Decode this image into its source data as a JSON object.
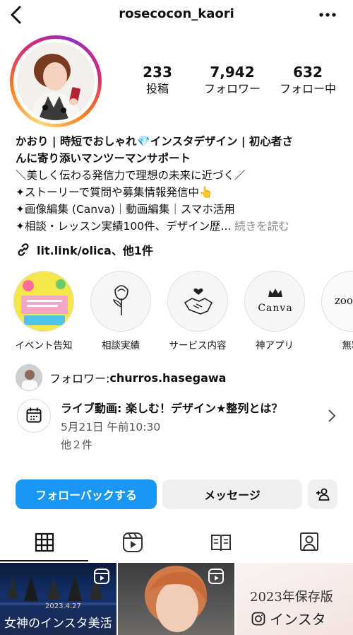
{
  "header": {
    "username": "rosecocon_kaori"
  },
  "stats": [
    {
      "value": "233",
      "label": "投稿"
    },
    {
      "value": "7,942",
      "label": "フォロワー"
    },
    {
      "value": "632",
      "label": "フォロー中"
    }
  ],
  "bio": {
    "name_line1": "かおり | 時短でおしゃれ💎インスタデザイン | 初心者さ",
    "name_line2": "んに寄り添いマンツーマンサポート",
    "line3": "＼美しく伝わる発信力で理想の未来に近づく／",
    "line4": "✦ストーリーで質問や募集情報発信中👆",
    "line5": "✦画像編集 (Canva)｜動画編集｜スマホ活用",
    "line6": "✦相談・レッスン実績100件、デザイン歴... ",
    "more_label": "続きを読む",
    "link": "lit.link/olica、他1件"
  },
  "highlights": [
    {
      "label": "イベント告知"
    },
    {
      "label": "相談実績"
    },
    {
      "label": "サービス内容"
    },
    {
      "label": "神アプリ",
      "circle_text": "Canva"
    },
    {
      "label": "無料",
      "circle_text": "zoo"
    }
  ],
  "followed_by": {
    "prefix": "フォロワー: ",
    "name": "churros.hasegawa"
  },
  "event": {
    "title": "ライブ動画: 楽しむ！デザイン★整列とは？",
    "time": "5月21日 午前10:30",
    "more": "他２件"
  },
  "buttons": {
    "follow_back": "フォローバックする",
    "message": "メッセージ"
  },
  "grid": [
    {
      "caption": "女神のインスタ美活",
      "date": "2023.4.27"
    },
    {
      "caption": ""
    },
    {
      "line1": "2023年保存版",
      "line2": "インスタ"
    }
  ],
  "colors": {
    "follow_button": "#1a97f2",
    "secondary_button": "#efefef",
    "text": "#111111"
  },
  "icons": [
    "back-icon",
    "more-icon",
    "link-icon",
    "calendar-icon",
    "chevron-right-icon",
    "add-person-icon",
    "grid-icon",
    "reels-icon",
    "guide-icon",
    "tagged-icon"
  ]
}
